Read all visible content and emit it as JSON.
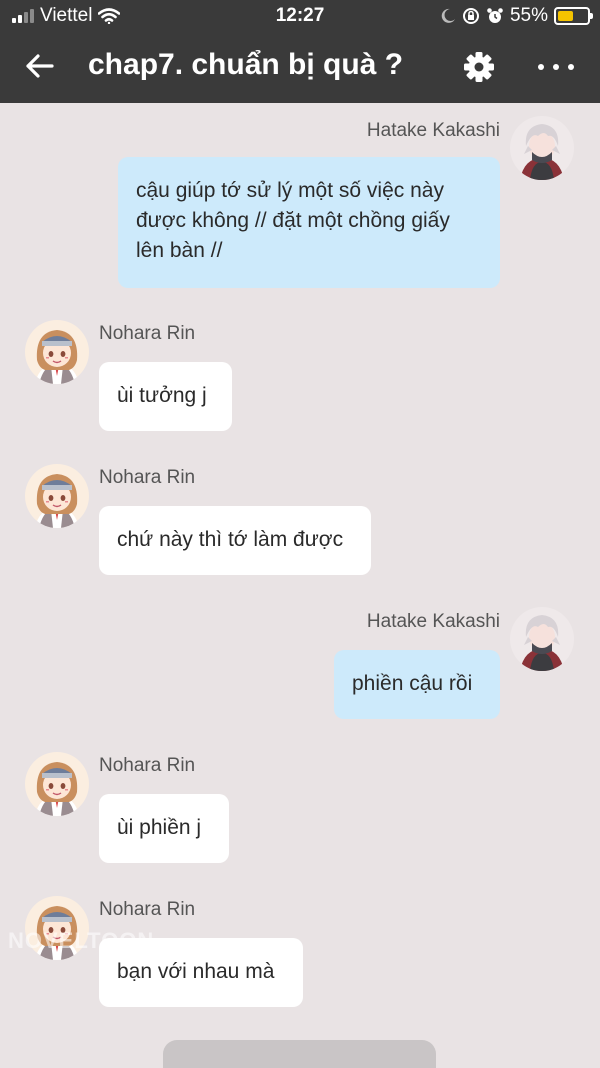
{
  "status": {
    "carrier": "Viettel",
    "time": "12:27",
    "battery": "55%"
  },
  "header": {
    "title": "chap7. chuẩn bị quà ?"
  },
  "messages": [
    {
      "sender": "Hatake Kakashi",
      "text": "cậu giúp tớ sử lý một số việc này\nđược không // đặt một chồng giấy\nlên bàn //"
    },
    {
      "sender": "Nohara Rin",
      "text": "ùi tưởng j"
    },
    {
      "sender": "Nohara Rin",
      "text": "chứ này thì tớ làm được"
    },
    {
      "sender": "Hatake Kakashi",
      "text": "phiền cậu rồi"
    },
    {
      "sender": "Nohara Rin",
      "text": "ùi phiền j"
    },
    {
      "sender": "Nohara Rin",
      "text": "bạn với nhau mà"
    }
  ],
  "watermark": "NOVELTOON",
  "colors": {
    "header_bg": "#3a3a3a",
    "page_bg": "#e9e3e4",
    "outgoing_bubble": "#cdeafb",
    "incoming_bubble": "#ffffff",
    "battery": "#f5c400"
  }
}
